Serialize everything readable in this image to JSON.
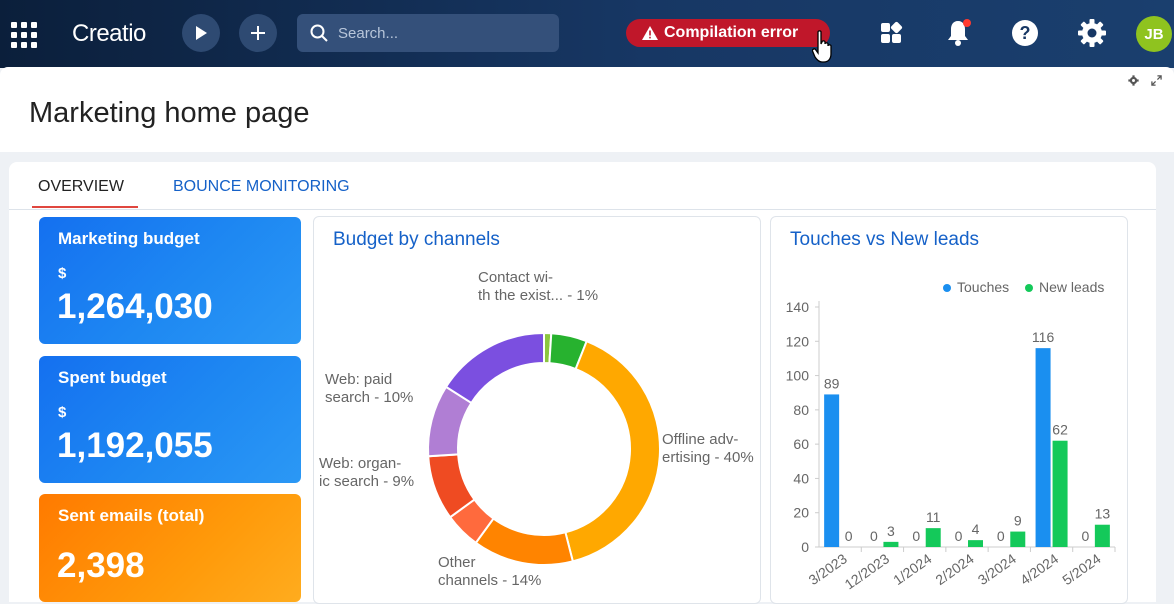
{
  "topbar": {
    "logo": "Creatio",
    "search_placeholder": "Search...",
    "compilation_error": "Compilation error",
    "avatar_initials": "JB"
  },
  "page": {
    "title": "Marketing home page"
  },
  "tabs": [
    {
      "label": "OVERVIEW",
      "active": true
    },
    {
      "label": "BOUNCE MONITORING",
      "active": false
    }
  ],
  "kpis": [
    {
      "title": "Marketing budget",
      "currency": "$",
      "value": "1,264,030",
      "color": "#1470f0"
    },
    {
      "title": "Spent budget",
      "currency": "$",
      "value": "1,192,055",
      "color": "#1470f0"
    },
    {
      "title": "Sent emails (total)",
      "value": "2,398",
      "color": "#ff8a00"
    }
  ],
  "chart_data": [
    {
      "type": "pie",
      "title": "Budget by channels",
      "slices": [
        {
          "name": "Contact with the existing customers",
          "display": [
            "Contact wi-",
            "th the exist... - 1%"
          ],
          "value": 1,
          "color": "#8cc63f"
        },
        {
          "name": "Other",
          "display": [],
          "value": 5,
          "color": "#27b22f"
        },
        {
          "name": "Offline advertising",
          "display": [
            "Offline adv-",
            "ertising - 40%"
          ],
          "value": 40,
          "color": "#ffa800"
        },
        {
          "name": "Other channels",
          "display": [
            "Other",
            "channels - 14%"
          ],
          "value": 14,
          "color": "#ff8400"
        },
        {
          "name": "Other 2",
          "display": [],
          "value": 5,
          "color": "#ff6a3d"
        },
        {
          "name": "Web: organic search",
          "display": [
            "Web: organ-",
            "ic search - 9%"
          ],
          "value": 9,
          "color": "#ef4b22"
        },
        {
          "name": "Web: paid search",
          "display": [
            "Web: paid",
            "search - 10%"
          ],
          "value": 10,
          "color": "#b07ed4"
        },
        {
          "name": "Other 3",
          "display": [],
          "value": 16,
          "color": "#7b4fe0"
        }
      ]
    },
    {
      "type": "bar",
      "title": "Touches vs New leads",
      "categories": [
        "3/2023",
        "12/2023",
        "1/2024",
        "2/2024",
        "3/2024",
        "4/2024",
        "5/2024"
      ],
      "series": [
        {
          "name": "Touches",
          "values": [
            89,
            0,
            0,
            0,
            0,
            116,
            0
          ],
          "color": "#1a8ff0"
        },
        {
          "name": "New leads",
          "values": [
            0,
            3,
            11,
            4,
            9,
            62,
            13
          ],
          "color": "#14c95a"
        }
      ],
      "yticks": [
        0,
        20,
        40,
        60,
        80,
        100,
        120,
        140
      ],
      "ylim": [
        0,
        140
      ],
      "legend": "top-right"
    }
  ]
}
